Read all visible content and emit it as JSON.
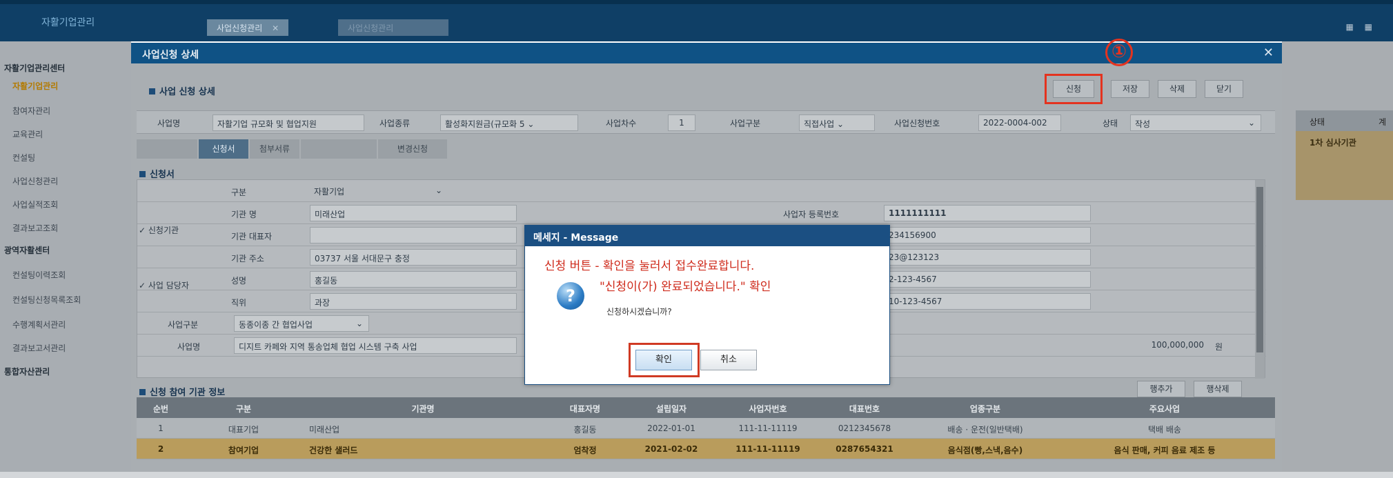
{
  "app": {
    "title": "자활기업관리",
    "tabs": [
      {
        "label": "사업신청관리"
      },
      {
        "label": "사업신청관리"
      }
    ]
  },
  "sidebar": {
    "items": [
      {
        "label": "자활기업관리센터",
        "kind": "section"
      },
      {
        "label": "자활기업관리",
        "kind": "active"
      },
      {
        "label": "참여자관리",
        "kind": "item"
      },
      {
        "label": "교육관리",
        "kind": "item"
      },
      {
        "label": "컨설팅",
        "kind": "item"
      },
      {
        "label": "사업신청관리",
        "kind": "item"
      },
      {
        "label": "사업실적조회",
        "kind": "item"
      },
      {
        "label": "결과보고조회",
        "kind": "item"
      },
      {
        "label": "광역자활센터",
        "kind": "section"
      },
      {
        "label": "컨설팅이력조회",
        "kind": "item"
      },
      {
        "label": "컨설팅신청목록조회",
        "kind": "item"
      },
      {
        "label": "수행계획서관리",
        "kind": "item"
      },
      {
        "label": "결과보고서관리",
        "kind": "item"
      },
      {
        "label": "통합자산관리",
        "kind": "section"
      }
    ]
  },
  "right_panel": {
    "header_labels": [
      "상태",
      "계"
    ],
    "highlight_text": "1차 심사기관"
  },
  "modal": {
    "title": "사업신청 상세",
    "close_symbol": "✕",
    "annotation_number": "①",
    "section_title": "사업 신청 상세",
    "actions": {
      "apply": "신청",
      "save": "저장",
      "delete": "삭제",
      "close": "닫기"
    },
    "info": {
      "business_name_label": "사업명",
      "business_name_value": "자활기업 규모화 및 협업지원",
      "business_type_label": "사업종류",
      "business_type_value": "활성화지원금(규모화 5",
      "year_label": "사업차수",
      "year_value": "1",
      "category_label": "사업구분",
      "category_value": "직접사업",
      "app_no_label": "사업신청번호",
      "app_no_value": "2022-0004-002",
      "status_label": "상태",
      "status_value": "작성"
    },
    "subtabs": [
      "",
      "신청서",
      "첨부서류",
      "",
      "변경신청"
    ],
    "form": {
      "section_title": "신청서",
      "group_org": "신청기관",
      "group_manager": "사업 담당자",
      "type_label": "구분",
      "type_value": "자활기업",
      "org_name_label": "기관 명",
      "org_name_value": "미래산업",
      "rep_label": "기관 대표자",
      "rep_value": "",
      "addr_label": "기관 주소",
      "addr_value": "03737   서울 서대문구 충정",
      "mgr_name_label": "성명",
      "mgr_name_value": "홍길동",
      "mgr_title_label": "직위",
      "mgr_title_value": "과장",
      "biz_reg_label": "사업자 등록번호",
      "biz_reg_value": "1111111111",
      "corp_no_value": "234156900",
      "fax_value": "23@123123",
      "tel_value": "2-123-4567",
      "mobile_value": "10-123-4567",
      "biz_cat_label": "사업구분",
      "biz_cat_value": "동종이종 간 협업사업",
      "biz_name_label": "사업명",
      "biz_name_value": "디지트 카페와 지역 통송업체 협업 시스템 구축 사업",
      "amount_value": "100,000,000",
      "amount_unit": "원"
    },
    "orgs": {
      "section_title": "신청 참여 기관 정보",
      "add_row": "행추가",
      "del_row": "행삭제",
      "columns": [
        "순번",
        "구분",
        "기관명",
        "대표자명",
        "설립일자",
        "사업자번호",
        "대표번호",
        "업종구분",
        "주요사업"
      ],
      "rows": [
        [
          "1",
          "대표기업",
          "미래산업",
          "홍길동",
          "2022-01-01",
          "111-11-11119",
          "0212345678",
          "배송 · 운전(일반택배)",
          "택배 배송"
        ],
        [
          "2",
          "참여기업",
          "건강한 샐러드",
          "엄착정",
          "2021-02-02",
          "111-11-11119",
          "0287654321",
          "음식점(빵,스낵,음수)",
          "음식 판매, 커피 음료 제조 등"
        ]
      ]
    }
  },
  "dialog": {
    "title": "메세지 - Message",
    "annotation_line1": "신청 버튼 - 확인을 눌러서 접수완료합니다.",
    "annotation_line2": "\"신청이(가) 완료되었습니다.\" 확인",
    "question": "신청하시겠습니까?",
    "ok_label": "확인",
    "cancel_label": "취소",
    "icon": "question-icon"
  },
  "colors": {
    "title_bar": "#0f5285",
    "annotation_red": "#e4331f",
    "selected_row": "#b99c5c"
  }
}
